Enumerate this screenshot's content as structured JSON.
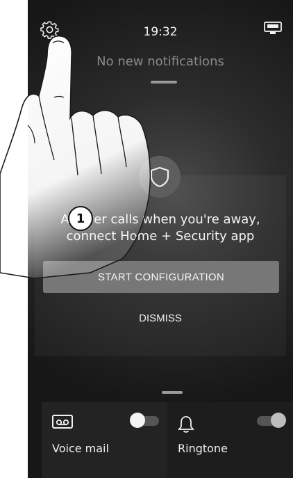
{
  "status_bar": {
    "time": "19:32"
  },
  "notifications": {
    "empty_text": "No new notifications"
  },
  "promo": {
    "line1": "Answer calls when you're away,",
    "line2": "connect Home + Security app",
    "start_label": "START CONFIGURATION",
    "dismiss_label": "DISMISS"
  },
  "tiles": {
    "voice_mail": {
      "label": "Voice mail",
      "enabled": false
    },
    "ringtone": {
      "label": "Ringtone",
      "enabled": true
    }
  },
  "annotation": {
    "step": "1"
  },
  "colors": {
    "screen_bg": "#1c1c1c",
    "button_bg": "#777777",
    "text": "#f4f4f4",
    "muted": "#8a8a8a"
  }
}
